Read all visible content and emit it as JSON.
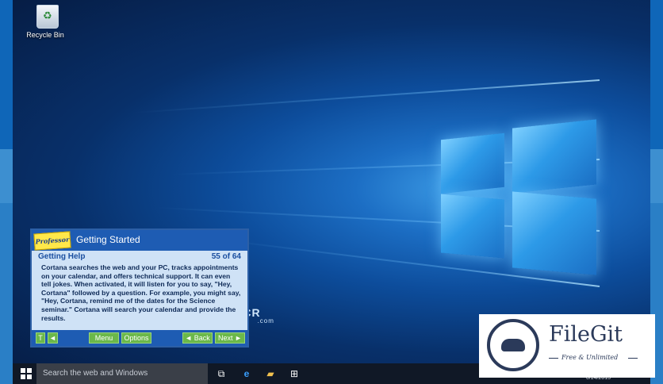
{
  "desktop": {
    "recycle_bin_label": "Recycle Bin"
  },
  "taskbar": {
    "search_placeholder": "Search the web and Windows",
    "clock_date": "6/14/2015",
    "icons": [
      "windows-start-icon",
      "task-view-icon",
      "edge-icon",
      "file-explorer-icon",
      "store-icon"
    ]
  },
  "tutorial": {
    "logo_text": "Professor",
    "title": "Getting Started",
    "section": "Getting Help",
    "page_count": "55 of 64",
    "body": "Cortana searches the web and your PC, tracks appointments on your calendar, and offers technical support. It can even tell jokes. When activated, it will listen for you to say, \"Hey, Cortana\" followed by a question. For example, you might say, \"Hey, Cortana, remind me of the dates for the Science seminar.\" Cortana will search your calendar and provide the results.",
    "text_button": "T",
    "menu_button": "Menu",
    "options_button": "Options",
    "back_button": "◄ Back",
    "next_button": "Next ►"
  },
  "watermarks": {
    "filecr": "FILECR",
    "filecr_domain": ".com",
    "filegit_name": "FileGit",
    "filegit_tagline": "Free & Unlimited"
  },
  "colors": {
    "tutorial_header": "#1e5cb3",
    "tutorial_button": "#6bb84a",
    "taskbar": "#101826"
  }
}
